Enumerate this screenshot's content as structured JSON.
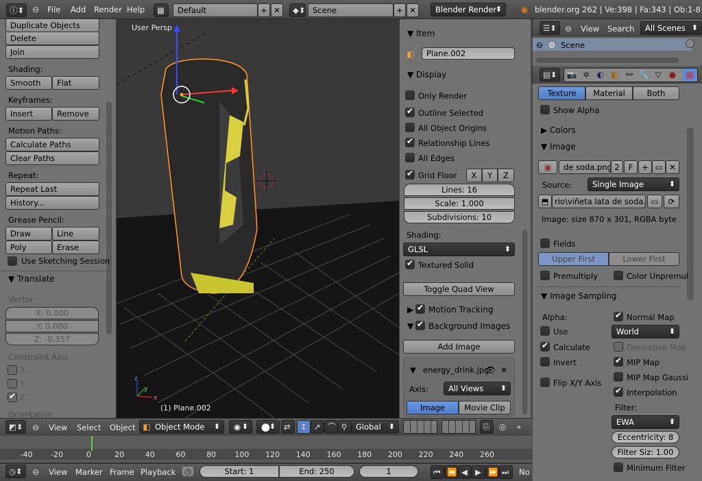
{
  "topbar": {
    "menus": [
      "File",
      "Add",
      "Render",
      "Help"
    ],
    "layout": "Default",
    "scene": "Scene",
    "engine": "Blender Render",
    "stats": "blender.org 262 | Ve:398 | Fa:343 | Ob:1-8 | La"
  },
  "toolshelf": {
    "buttons": {
      "duplicate": "Duplicate Objects",
      "delete": "Delete",
      "join": "Join"
    },
    "shading_label": "Shading:",
    "smooth": "Smooth",
    "flat": "Flat",
    "keyframes_label": "Keyframes:",
    "insert": "Insert",
    "remove": "Remove",
    "motion_label": "Motion Paths:",
    "calc_paths": "Calculate Paths",
    "clear_paths": "Clear Paths",
    "repeat_label": "Repeat:",
    "repeat_last": "Repeat Last",
    "history": "History...",
    "grease_label": "Grease Pencil:",
    "draw": "Draw",
    "line": "Line",
    "poly": "Poly",
    "erase": "Erase",
    "sketch": "Use Sketching Session",
    "translate_title": "Translate",
    "vector_label": "Vector",
    "x": "X: 0.000",
    "y": "Y: 0.000",
    "z": "Z: -0.357",
    "constraint_label": "Constraint Axis",
    "cx": "X",
    "cy": "Y",
    "cz": "Z",
    "orientation": "Orientation"
  },
  "viewport": {
    "title": "User Persp",
    "object": "(1) Plane.002"
  },
  "npanel": {
    "item_title": "Item",
    "item_name": "Plane.002",
    "display_title": "Display",
    "only_render": "Only Render",
    "outline": "Outline Selected",
    "origins": "All Object Origins",
    "rel_lines": "Relationship Lines",
    "all_edges": "All Edges",
    "grid_floor": "Grid Floor",
    "gx": "X",
    "gy": "Y",
    "gz": "Z",
    "lines": "Lines: 16",
    "scale": "Scale: 1.000",
    "subdiv": "Subdivisions: 10",
    "shading_label": "Shading:",
    "shading_val": "GLSL",
    "textured": "Textured Solid",
    "quad": "Toggle Quad View",
    "motion_tracking": "Motion Tracking",
    "bg_images": "Background Images",
    "add_image": "Add Image",
    "bg_file": "energy_drink.jpg",
    "axis_label": "Axis:",
    "axis_val": "All Views",
    "image_tab": "Image",
    "clip_tab": "Movie Clip"
  },
  "view_header": {
    "menus": [
      "View",
      "Select",
      "Object"
    ],
    "mode": "Object Mode",
    "orientation": "Global"
  },
  "timeline": {
    "ticks": [
      "-40",
      "-20",
      "0",
      "20",
      "40",
      "60",
      "80",
      "100",
      "120",
      "140",
      "160",
      "180",
      "200",
      "220",
      "240",
      "260"
    ],
    "menus": [
      "View",
      "Marker",
      "Frame",
      "Playback"
    ],
    "start": "Start: 1",
    "end": "End: 250",
    "frame": "1",
    "no": "No"
  },
  "outliner": {
    "menus": [
      "View",
      "Search"
    ],
    "filter": "All Scenes",
    "scene": "Scene"
  },
  "properties": {
    "tabs": {
      "texture": "Texture",
      "material": "Material",
      "both": "Both"
    },
    "show_alpha": "Show Alpha",
    "colors": "Colors",
    "image_title": "Image",
    "img_name": "de soda.png",
    "img_users": "2",
    "img_f": "F",
    "source_label": "Source:",
    "source_val": "Single Image",
    "path": "rio\\viñeta lata de soda.png",
    "info": "Image: size 870 x 301, RGBA byte",
    "fields": "Fields",
    "upper": "Upper First",
    "lower": "Lower First",
    "premul": "Premultiply",
    "color_unpremul": "Color Unpremul",
    "sampling_title": "Image Sampling",
    "alpha_label": "Alpha:",
    "use": "Use",
    "calculate": "Calculate",
    "invert": "Invert",
    "flip": "Flip X/Y Axis",
    "normal_map": "Normal Map",
    "world": "World",
    "deriv": "Derivative Map",
    "mip": "MIP Map",
    "mip_gauss": "MIP Map Gaussi",
    "interp": "Interpolation",
    "filter_label": "Filter:",
    "filter_val": "EWA",
    "ecc": "Eccentricity: 8",
    "filter_size": "Filter Siz: 1.00",
    "min_filter": "Minimum Filter"
  }
}
